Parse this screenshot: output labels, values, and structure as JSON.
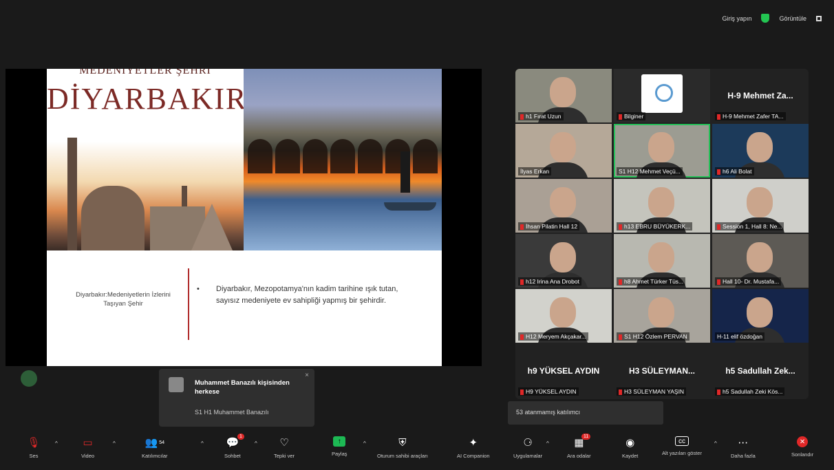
{
  "topbar": {
    "signin": "Giriş yapın",
    "view": "Görüntüle"
  },
  "slide": {
    "top_text": "MEDENİYETLER ŞEHRİ",
    "title": "DİYARBAKIR",
    "caption_left": "Diyarbakır:Medeniyetlerin İzlerini Taşıyan Şehir",
    "caption_right": "Diyarbakır, Mezopotamya'nın kadim tarihine ışık tutan, sayısız medeniyete ev sahipliği yapmış bir şehirdir."
  },
  "notification": {
    "title": "Muhammet Banazılı kişisinden herkese",
    "message": "S1 H1 Muhammet Banazılı",
    "close": "×"
  },
  "participants": [
    "h1 Fırat Uzun",
    "Bilginer",
    "H-9 Mehmet Zafer TA...",
    "İlyas Erkan",
    "S1 H12 Mehmet Veçü...",
    "h6 Ali Bolat",
    "İhsan Pilatin Hall 12",
    "h13 EBRU BÜYÜKERK...",
    "Session 1, Hall 8: Ne...",
    "h12 Irina Ana Drobot",
    "h8 Ahmet Türker Tüs...",
    "Hall 10- Dr. Mustafa...",
    "H12 Meryem Akçakar...",
    "S1 H12 Özlem PERVAN",
    "H-11 elif özdoğan",
    "H9 YÜKSEL AYDIN",
    "H3 SÜLEYMAN YAŞIN",
    "h5 Sadullah Zeki Kös..."
  ],
  "bignames": [
    "H-9 Mehmet Za...",
    "h9 YÜKSEL AYDIN",
    "H3 SÜLEYMAN...",
    "h5 Sadullah Zek..."
  ],
  "unassigned": "53 atanmamış katılımcı",
  "toolbar": {
    "audio": "Ses",
    "video": "Video",
    "participants": "Katılımcılar",
    "participants_count": "54",
    "chat": "Sohbet",
    "chat_badge": "1",
    "react": "Tepki ver",
    "share": "Paylaş",
    "host_tools": "Oturum sahibi araçları",
    "ai": "AI Companion",
    "apps": "Uygulamalar",
    "breakout": "Ara odalar",
    "breakout_badge": "11",
    "record": "Kaydet",
    "captions": "Alt yazıları göster",
    "more": "Daha fazla",
    "end": "Sonlandır"
  }
}
